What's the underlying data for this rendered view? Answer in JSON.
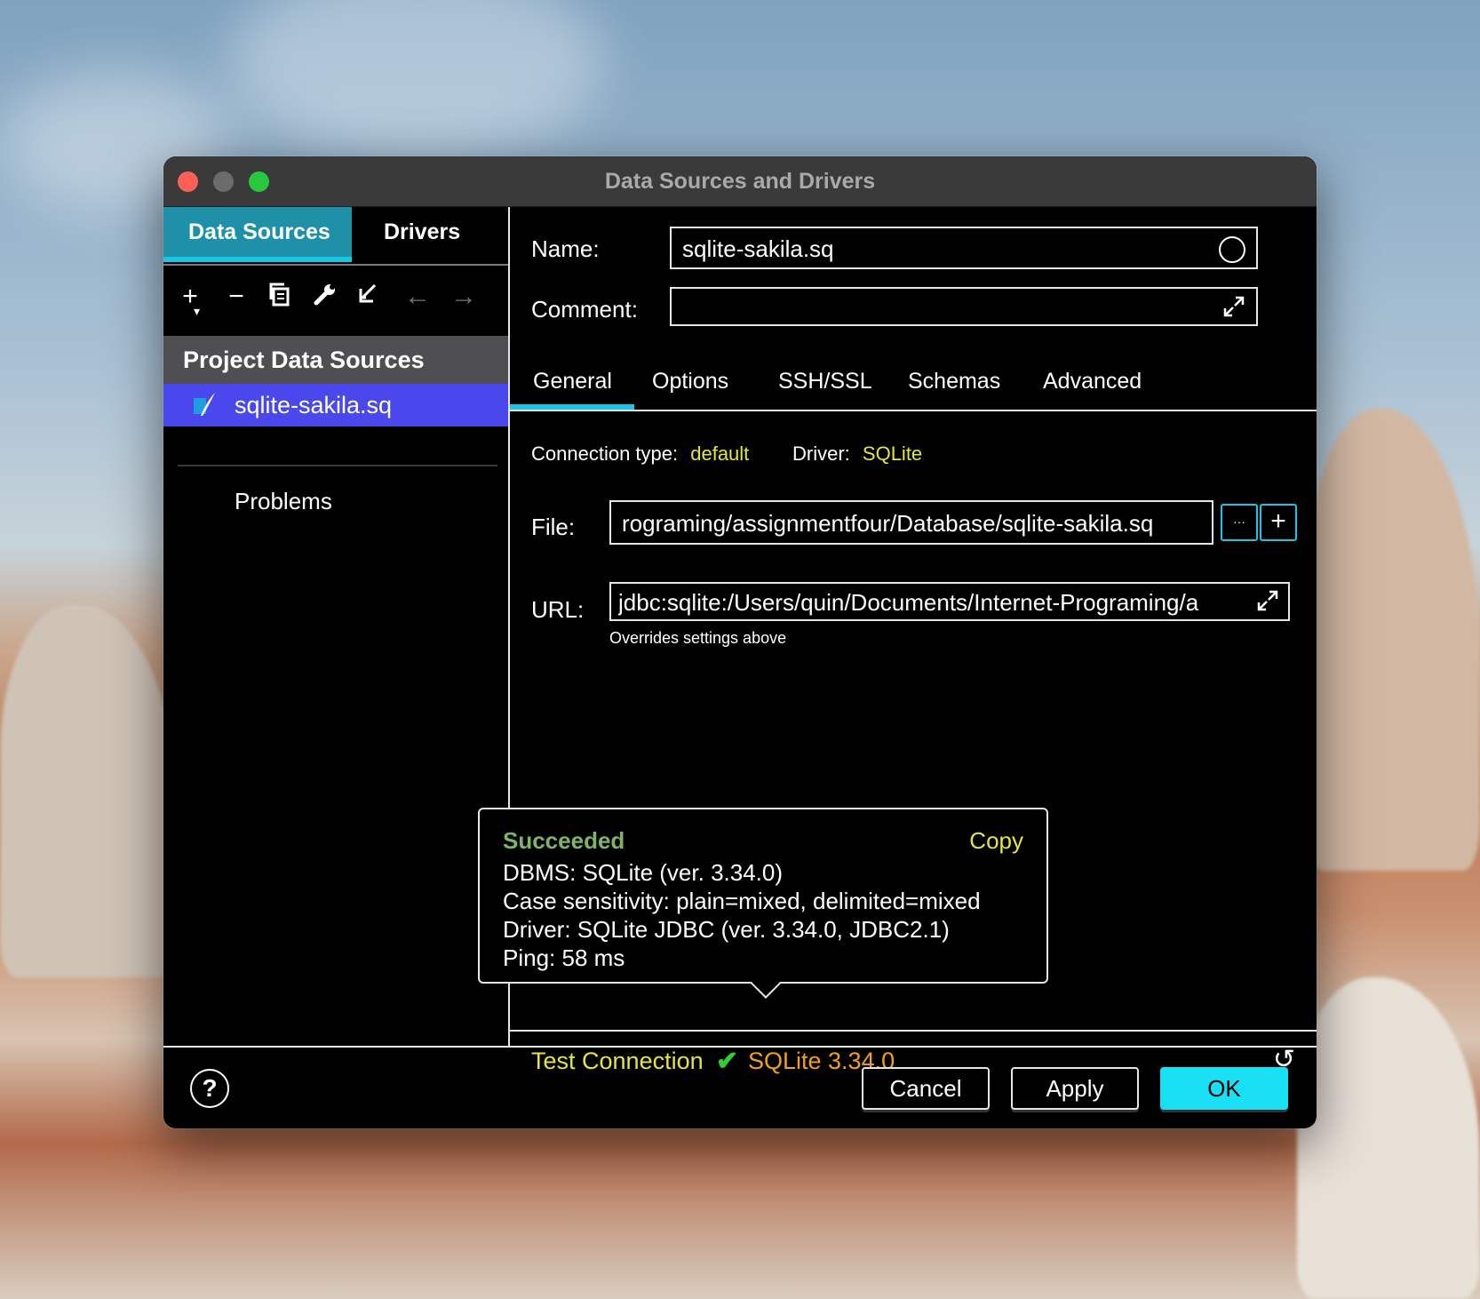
{
  "window": {
    "title": "Data Sources and Drivers"
  },
  "left_panel": {
    "tabs": [
      "Data Sources",
      "Drivers"
    ],
    "toolbar_icons": [
      "add-icon",
      "remove-icon",
      "duplicate-icon",
      "wrench-icon",
      "import-icon",
      "back-arrow-icon",
      "forward-arrow-icon"
    ],
    "group_title": "Project Data Sources",
    "selected_item": "sqlite-sakila.sq",
    "problems_label": "Problems"
  },
  "form": {
    "name_label": "Name:",
    "name_value": "sqlite-sakila.sq",
    "comment_label": "Comment:",
    "comment_value": ""
  },
  "tabs": [
    "General",
    "Options",
    "SSH/SSL",
    "Schemas",
    "Advanced"
  ],
  "general": {
    "connection_type_label": "Connection type:",
    "connection_type_value": "default",
    "driver_label": "Driver:",
    "driver_value": "SQLite",
    "file_label": "File:",
    "file_value": "rograming/assignmentfour/Database/sqlite-sakila.sq",
    "file_browse_label": "···",
    "file_add_label": "+",
    "url_label": "URL:",
    "url_value": "jdbc:sqlite:/Users/quin/Documents/Internet-Programing/a",
    "url_hint": "Overrides settings above"
  },
  "popup": {
    "status": "Succeeded",
    "copy_label": "Copy",
    "lines": [
      "DBMS: SQLite (ver. 3.34.0)",
      "Case sensitivity: plain=mixed, delimited=mixed",
      "Driver: SQLite JDBC (ver. 3.34.0, JDBC2.1)",
      "Ping: 58 ms"
    ]
  },
  "test": {
    "label": "Test Connection",
    "result": "SQLite 3.34.0"
  },
  "footer": {
    "help_label": "?",
    "cancel_label": "Cancel",
    "apply_label": "Apply",
    "ok_label": "OK"
  },
  "colors": {
    "accent": "#19c6e6",
    "selection": "#4a48ec",
    "yellow_text": "#e5e53a",
    "success_green": "#7eb36a",
    "version_orange": "#f0a020"
  }
}
